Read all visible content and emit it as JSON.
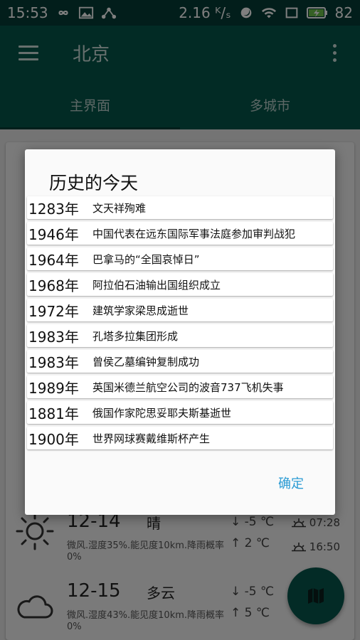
{
  "status_bar": {
    "time": "15:53",
    "speed": "2.16 ᴷ/ₛ",
    "battery": "82"
  },
  "app_bar": {
    "title": "北京"
  },
  "tabs": [
    {
      "label": "主界面"
    },
    {
      "label": "多城市"
    }
  ],
  "forecast": [
    {
      "date": "12-14",
      "condition": "晴",
      "detail": "微风.湿度35%.能见度10km.降雨概率0%",
      "low": "↓ -5 ℃",
      "high": "↑ 2 ℃",
      "sunrise": "07:28",
      "sunset": "16:50",
      "icon": "sun-icon"
    },
    {
      "date": "12-15",
      "condition": "多云",
      "detail": "微风.湿度43%.能见度10km.降雨概率0%",
      "low": "↓ -5 ℃",
      "high": "↑ 5 ℃",
      "icon": "cloud-icon"
    }
  ],
  "dialog": {
    "title": "历史的今天",
    "items": [
      {
        "year": "1283年",
        "event": "文天祥殉难"
      },
      {
        "year": "1946年",
        "event": "中国代表在远东国际军事法庭参加审判战犯"
      },
      {
        "year": "1964年",
        "event": "巴拿马的“全国哀悼日”"
      },
      {
        "year": "1968年",
        "event": "阿拉伯石油输出国组织成立"
      },
      {
        "year": "1972年",
        "event": "建筑学家梁思成逝世"
      },
      {
        "year": "1983年",
        "event": "孔塔多拉集团形成"
      },
      {
        "year": "1983年",
        "event": "曾侯乙墓编钟复制成功"
      },
      {
        "year": "1989年",
        "event": "英国米德兰航空公司的波音737飞机失事"
      },
      {
        "year": "1881年",
        "event": "俄国作家陀思妥耶夫斯基逝世"
      },
      {
        "year": "1900年",
        "event": "世界网球赛戴维斯杯产生"
      }
    ],
    "ok_label": "确定"
  },
  "colors": {
    "primary": "#05564b",
    "primary_dark": "#043d36",
    "accent": "#2a9bd4"
  }
}
